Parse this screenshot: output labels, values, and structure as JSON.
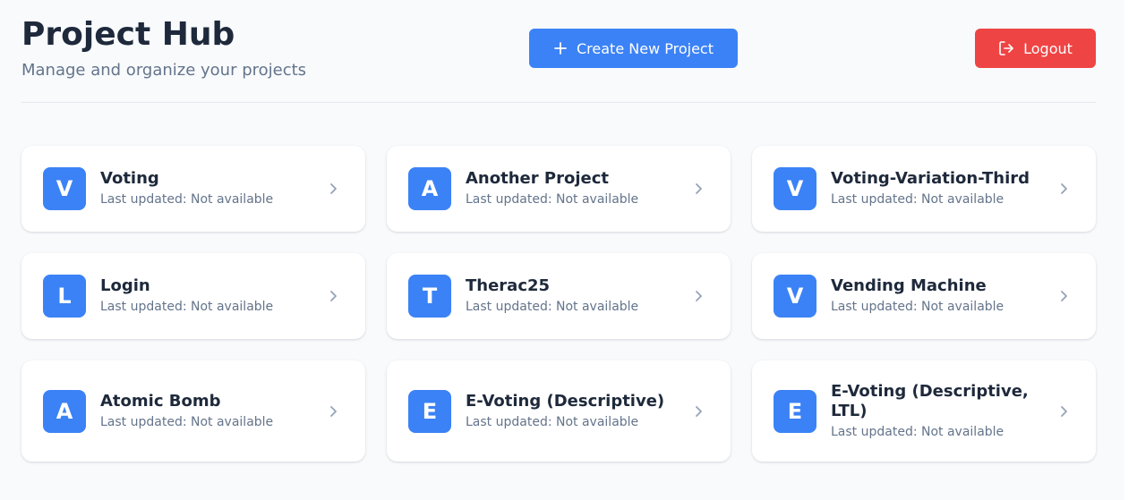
{
  "header": {
    "title": "Project Hub",
    "subtitle": "Manage and organize your projects",
    "create_button_label": "Create New Project",
    "create_icon": "plus-icon",
    "logout_button_label": "Logout",
    "logout_icon": "logout-icon"
  },
  "colors": {
    "accent": "#3b82f6",
    "danger": "#ef4444",
    "title_text": "#1e293b",
    "muted_text": "#64748b",
    "page_background": "#f8fafc"
  },
  "projects": [
    {
      "initial": "V",
      "name": "Voting",
      "updated": "Last updated: Not available"
    },
    {
      "initial": "A",
      "name": "Another Project",
      "updated": "Last updated: Not available"
    },
    {
      "initial": "V",
      "name": "Voting-Variation-Third",
      "updated": "Last updated: Not available"
    },
    {
      "initial": "L",
      "name": "Login",
      "updated": "Last updated: Not available"
    },
    {
      "initial": "T",
      "name": "Therac25",
      "updated": "Last updated: Not available"
    },
    {
      "initial": "V",
      "name": "Vending Machine",
      "updated": "Last updated: Not available"
    },
    {
      "initial": "A",
      "name": "Atomic Bomb",
      "updated": "Last updated: Not available"
    },
    {
      "initial": "E",
      "name": "E-Voting (Descriptive)",
      "updated": "Last updated: Not available"
    },
    {
      "initial": "E",
      "name": "E-Voting (Descriptive, LTL)",
      "updated": "Last updated: Not available"
    }
  ],
  "card_icon": "chevron-right-icon"
}
